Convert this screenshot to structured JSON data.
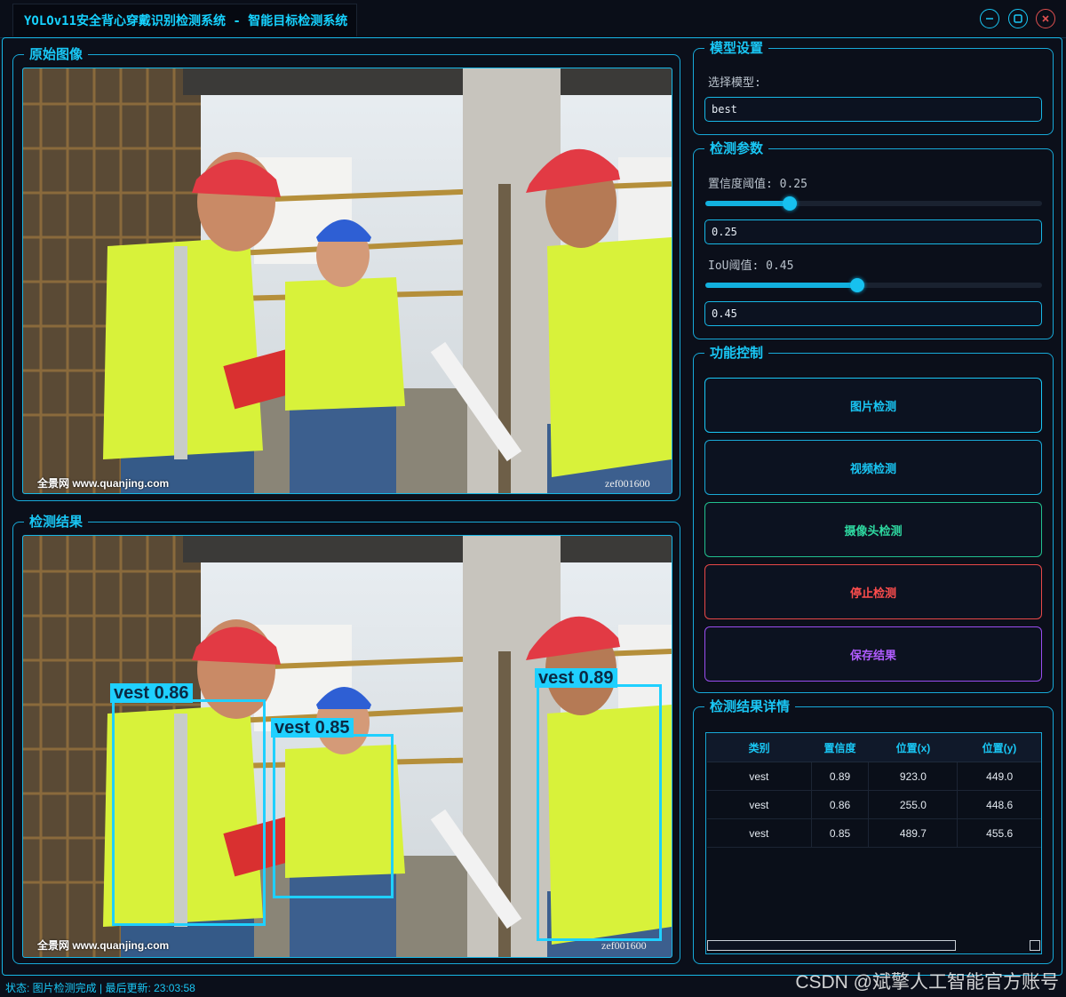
{
  "window": {
    "title": "YOLOv11安全背心穿戴识别检测系统 - 智能目标检测系统",
    "controls": [
      "minimize-icon",
      "maximize-icon",
      "close-icon"
    ]
  },
  "original": {
    "title": "原始图像",
    "credit": "全景网 www.quanjing.com",
    "code": "zef001600"
  },
  "result": {
    "title": "检测结果",
    "credit": "全景网 www.quanjing.com",
    "code": "zef001600",
    "detections": [
      {
        "label": "vest 0.86"
      },
      {
        "label": "vest 0.85"
      },
      {
        "label": "vest 0.89"
      }
    ]
  },
  "model": {
    "title": "模型设置",
    "label": "选择模型:",
    "value": "best"
  },
  "params": {
    "title": "检测参数",
    "conf_label": "置信度阈值: 0.25",
    "conf_value": "0.25",
    "conf_level": 0.25,
    "iou_label": "IoU阈值: 0.45",
    "iou_value": "0.45",
    "iou_level": 0.45
  },
  "controls": {
    "title": "功能控制",
    "image_btn": "图片检测",
    "video_btn": "视频检测",
    "camera_btn": "摄像头检测",
    "stop_btn": "停止检测",
    "save_btn": "保存结果"
  },
  "details": {
    "title": "检测结果详情",
    "headers": [
      "类别",
      "置信度",
      "位置(x)",
      "位置(y)"
    ],
    "rows": [
      [
        "vest",
        "0.89",
        "923.0",
        "449.0"
      ],
      [
        "vest",
        "0.86",
        "255.0",
        "448.6"
      ],
      [
        "vest",
        "0.85",
        "489.7",
        "455.6"
      ]
    ]
  },
  "status": "状态: 图片检测完成 | 最后更新: 23:03:58",
  "watermark": "CSDN @斌擎人工智能官方账号",
  "colors": {
    "accent": "#19c7f5",
    "camera": "#2ed8a0",
    "stop": "#ff4d4d",
    "save": "#b05cff",
    "background": "#0b0f1a"
  }
}
